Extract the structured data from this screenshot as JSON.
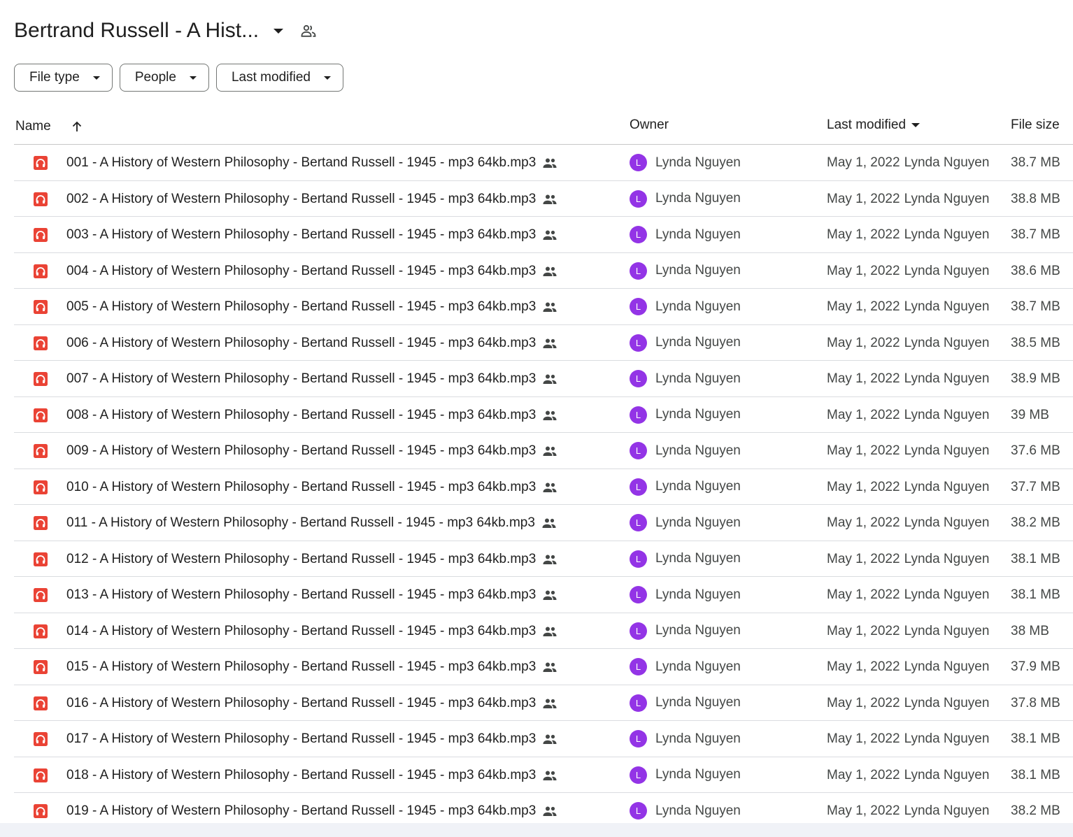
{
  "header": {
    "title": "Bertrand Russell - A Hist...",
    "dropdown_icon": "chevron-down-icon",
    "share_icon": "shared-people-icon"
  },
  "filters": [
    {
      "label": "File type"
    },
    {
      "label": "People"
    },
    {
      "label": "Last modified"
    }
  ],
  "columns": {
    "name": "Name",
    "owner": "Owner",
    "last_modified": "Last modified",
    "file_size": "File size"
  },
  "colors": {
    "avatar": "#9334e6",
    "audio_icon": "#ea4335"
  },
  "files": [
    {
      "name": "001 - A History of Western Philosophy - Bertand Russell - 1945 - mp3 64kb.mp3",
      "owner": "Lynda Nguyen",
      "owner_initial": "L",
      "modified_date": "May 1, 2022",
      "modified_by": "Lynda Nguyen",
      "size": "38.7 MB"
    },
    {
      "name": "002 - A History of Western Philosophy - Bertand Russell - 1945 - mp3 64kb.mp3",
      "owner": "Lynda Nguyen",
      "owner_initial": "L",
      "modified_date": "May 1, 2022",
      "modified_by": "Lynda Nguyen",
      "size": "38.8 MB"
    },
    {
      "name": "003 - A History of Western Philosophy - Bertand Russell - 1945 - mp3 64kb.mp3",
      "owner": "Lynda Nguyen",
      "owner_initial": "L",
      "modified_date": "May 1, 2022",
      "modified_by": "Lynda Nguyen",
      "size": "38.7 MB"
    },
    {
      "name": "004 - A History of Western Philosophy - Bertand Russell - 1945 - mp3 64kb.mp3",
      "owner": "Lynda Nguyen",
      "owner_initial": "L",
      "modified_date": "May 1, 2022",
      "modified_by": "Lynda Nguyen",
      "size": "38.6 MB"
    },
    {
      "name": "005 - A History of Western Philosophy - Bertand Russell - 1945 - mp3 64kb.mp3",
      "owner": "Lynda Nguyen",
      "owner_initial": "L",
      "modified_date": "May 1, 2022",
      "modified_by": "Lynda Nguyen",
      "size": "38.7 MB"
    },
    {
      "name": "006 - A History of Western Philosophy - Bertand Russell - 1945 - mp3 64kb.mp3",
      "owner": "Lynda Nguyen",
      "owner_initial": "L",
      "modified_date": "May 1, 2022",
      "modified_by": "Lynda Nguyen",
      "size": "38.5 MB"
    },
    {
      "name": "007 - A History of Western Philosophy - Bertand Russell - 1945 - mp3 64kb.mp3",
      "owner": "Lynda Nguyen",
      "owner_initial": "L",
      "modified_date": "May 1, 2022",
      "modified_by": "Lynda Nguyen",
      "size": "38.9 MB"
    },
    {
      "name": "008 - A History of Western Philosophy - Bertand Russell - 1945 - mp3 64kb.mp3",
      "owner": "Lynda Nguyen",
      "owner_initial": "L",
      "modified_date": "May 1, 2022",
      "modified_by": "Lynda Nguyen",
      "size": "39 MB"
    },
    {
      "name": "009 - A History of Western Philosophy - Bertand Russell - 1945 - mp3 64kb.mp3",
      "owner": "Lynda Nguyen",
      "owner_initial": "L",
      "modified_date": "May 1, 2022",
      "modified_by": "Lynda Nguyen",
      "size": "37.6 MB"
    },
    {
      "name": "010 - A History of Western Philosophy - Bertand Russell - 1945 - mp3 64kb.mp3",
      "owner": "Lynda Nguyen",
      "owner_initial": "L",
      "modified_date": "May 1, 2022",
      "modified_by": "Lynda Nguyen",
      "size": "37.7 MB"
    },
    {
      "name": "011 - A History of Western Philosophy - Bertand Russell - 1945 - mp3 64kb.mp3",
      "owner": "Lynda Nguyen",
      "owner_initial": "L",
      "modified_date": "May 1, 2022",
      "modified_by": "Lynda Nguyen",
      "size": "38.2 MB"
    },
    {
      "name": "012 - A History of Western Philosophy - Bertand Russell - 1945 - mp3 64kb.mp3",
      "owner": "Lynda Nguyen",
      "owner_initial": "L",
      "modified_date": "May 1, 2022",
      "modified_by": "Lynda Nguyen",
      "size": "38.1 MB"
    },
    {
      "name": "013 - A History of Western Philosophy - Bertand Russell - 1945 - mp3 64kb.mp3",
      "owner": "Lynda Nguyen",
      "owner_initial": "L",
      "modified_date": "May 1, 2022",
      "modified_by": "Lynda Nguyen",
      "size": "38.1 MB"
    },
    {
      "name": "014 - A History of Western Philosophy - Bertand Russell - 1945 - mp3 64kb.mp3",
      "owner": "Lynda Nguyen",
      "owner_initial": "L",
      "modified_date": "May 1, 2022",
      "modified_by": "Lynda Nguyen",
      "size": "38 MB"
    },
    {
      "name": "015 - A History of Western Philosophy - Bertand Russell - 1945 - mp3 64kb.mp3",
      "owner": "Lynda Nguyen",
      "owner_initial": "L",
      "modified_date": "May 1, 2022",
      "modified_by": "Lynda Nguyen",
      "size": "37.9 MB"
    },
    {
      "name": "016 - A History of Western Philosophy - Bertand Russell - 1945 - mp3 64kb.mp3",
      "owner": "Lynda Nguyen",
      "owner_initial": "L",
      "modified_date": "May 1, 2022",
      "modified_by": "Lynda Nguyen",
      "size": "37.8 MB"
    },
    {
      "name": "017 - A History of Western Philosophy - Bertand Russell - 1945 - mp3 64kb.mp3",
      "owner": "Lynda Nguyen",
      "owner_initial": "L",
      "modified_date": "May 1, 2022",
      "modified_by": "Lynda Nguyen",
      "size": "38.1 MB"
    },
    {
      "name": "018 - A History of Western Philosophy - Bertand Russell - 1945 - mp3 64kb.mp3",
      "owner": "Lynda Nguyen",
      "owner_initial": "L",
      "modified_date": "May 1, 2022",
      "modified_by": "Lynda Nguyen",
      "size": "38.1 MB"
    },
    {
      "name": "019 - A History of Western Philosophy - Bertand Russell - 1945 - mp3 64kb.mp3",
      "owner": "Lynda Nguyen",
      "owner_initial": "L",
      "modified_date": "May 1, 2022",
      "modified_by": "Lynda Nguyen",
      "size": "38.2 MB"
    }
  ]
}
